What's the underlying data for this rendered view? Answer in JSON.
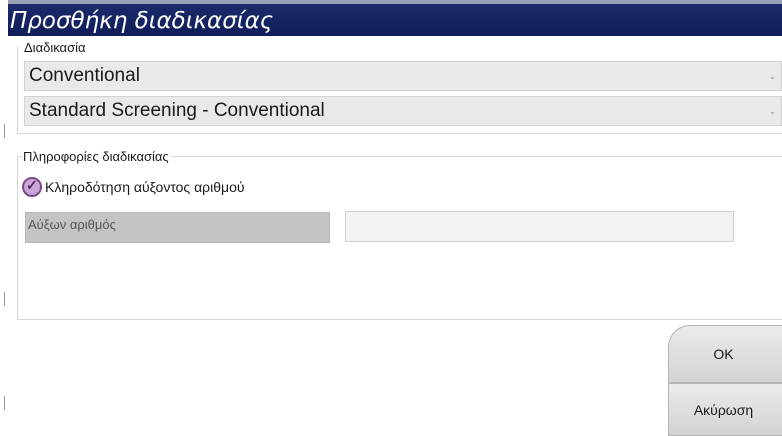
{
  "dialog": {
    "title": "Προσθήκη διαδικασίας"
  },
  "procedure_group": {
    "legend": "Διαδικασία",
    "type_select": {
      "value": "Conventional"
    },
    "procedure_select": {
      "value": "Standard Screening - Conventional"
    }
  },
  "info_group": {
    "legend": "Πληροφορίες διαδικασίας",
    "auto_accession": {
      "label": "Κληροδότηση αύξοντος αριθμού",
      "checked": true
    },
    "accession_field": {
      "label": "Αύξων αριθμός",
      "value": ""
    }
  },
  "buttons": {
    "ok": "OK",
    "cancel": "Ακύρωση"
  },
  "icons": {
    "dropdown": "chevron-down-icon",
    "check": "checkmark-icon"
  },
  "colors": {
    "titlebar": "#13235f",
    "checkbox_fill": "#c9a6d6",
    "checkbox_border": "#7b4a8c"
  }
}
